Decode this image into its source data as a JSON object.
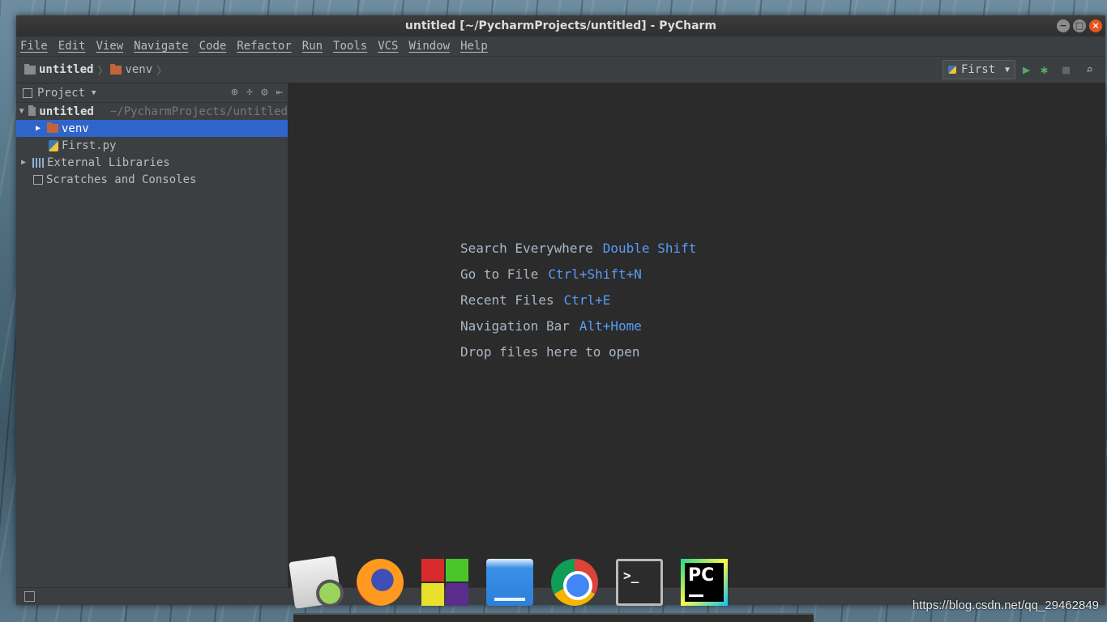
{
  "window": {
    "title": "untitled [~/PycharmProjects/untitled] - PyCharm",
    "controls": [
      "−",
      "□",
      "×"
    ]
  },
  "menu": [
    "File",
    "Edit",
    "View",
    "Navigate",
    "Code",
    "Refactor",
    "Run",
    "Tools",
    "VCS",
    "Window",
    "Help"
  ],
  "breadcrumb": [
    {
      "label": "untitled",
      "icon": "folder-icon"
    },
    {
      "label": "venv",
      "icon": "venv-folder-icon"
    }
  ],
  "toolbar": {
    "run_config": "First",
    "icons": [
      "run-icon",
      "debug-icon",
      "stop-icon",
      "search-icon"
    ]
  },
  "project_panel": {
    "title": "Project",
    "tree": [
      {
        "label": "untitled",
        "path": "~/PycharmProjects/untitled",
        "expanded": true,
        "bold": true
      },
      {
        "label": "venv",
        "selected": true
      },
      {
        "label": "First.py"
      },
      {
        "label": "External Libraries"
      },
      {
        "label": "Scratches and Consoles"
      }
    ]
  },
  "editor_hints": [
    {
      "label": "Search Everywhere",
      "key": "Double Shift"
    },
    {
      "label": "Go to File",
      "key": "Ctrl+Shift+N"
    },
    {
      "label": "Recent Files",
      "key": "Ctrl+E"
    },
    {
      "label": "Navigation Bar",
      "key": "Alt+Home"
    },
    {
      "label": "Drop files here to open",
      "key": ""
    }
  ],
  "dock": [
    "image-viewer-icon",
    "firefox-icon",
    "virtualbox-icon",
    "files-icon",
    "chrome-icon",
    "terminal-icon",
    "pycharm-icon"
  ],
  "dock_text": {
    "terminal": ">_",
    "pycharm": "PC"
  },
  "watermark": "https://blog.csdn.net/qq_29462849"
}
